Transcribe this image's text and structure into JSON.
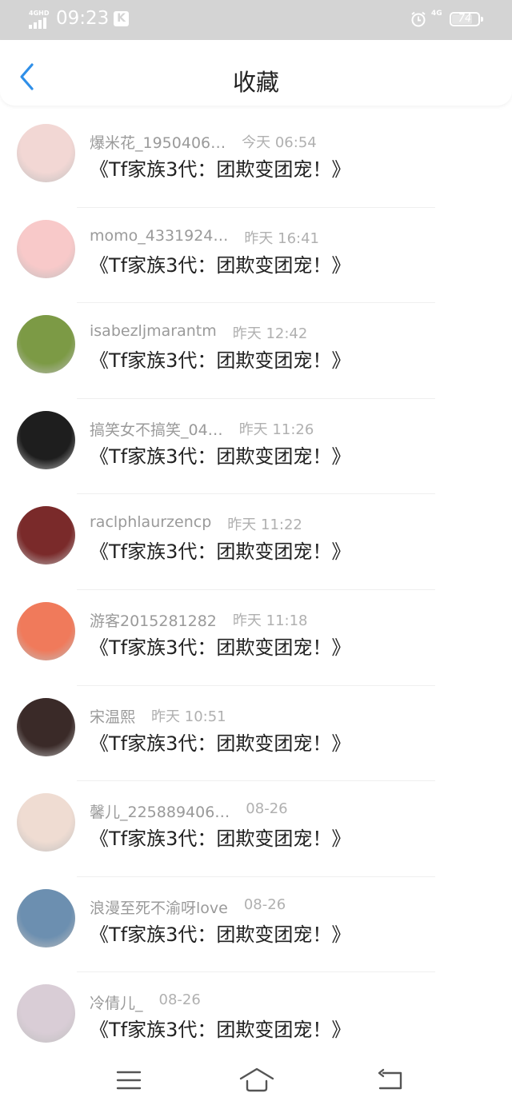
{
  "status_bar": {
    "network_label": "4GHD",
    "time": "09:23",
    "badge": "K",
    "network_right": "4G",
    "battery_percent": "74",
    "battery_level": 0.74,
    "icons": [
      "signal-icon",
      "k-app-icon",
      "alarm-icon",
      "battery-icon"
    ]
  },
  "header": {
    "back_icon": "chevron-left-icon",
    "title": "收藏",
    "accent_color": "#2f8fe8"
  },
  "list": {
    "items": [
      {
        "user": "爆米花_1950406…",
        "time": "今天 06:54",
        "title": "《Tf家族3代：团欺变团宠！》",
        "avatar_color": "#f2d7d4"
      },
      {
        "user": "momo_4331924…",
        "time": "昨天 16:41",
        "title": "《Tf家族3代：团欺变团宠！》",
        "avatar_color": "#f8c9c9"
      },
      {
        "user": "isabezljmarantm",
        "time": "昨天 12:42",
        "title": "《Tf家族3代：团欺变团宠！》",
        "avatar_color": "#7c9a45"
      },
      {
        "user": "搞笑女不搞笑_04…",
        "time": "昨天 11:26",
        "title": "《Tf家族3代：团欺变团宠！》",
        "avatar_color": "#1e1e1e"
      },
      {
        "user": "raclphlaurzencp",
        "time": "昨天 11:22",
        "title": "《Tf家族3代：团欺变团宠！》",
        "avatar_color": "#7a2a2a"
      },
      {
        "user": "游客2015281282",
        "time": "昨天 11:18",
        "title": "《Tf家族3代：团欺变团宠！》",
        "avatar_color": "#f07a5b"
      },
      {
        "user": "宋温熙",
        "time": "昨天 10:51",
        "title": "《Tf家族3代：团欺变团宠！》",
        "avatar_color": "#3a2a28"
      },
      {
        "user": "馨儿_225889406…",
        "time": "08-26",
        "title": "《Tf家族3代：团欺变团宠！》",
        "avatar_color": "#efdcd2"
      },
      {
        "user": "浪漫至死不渝呀love",
        "time": "08-26",
        "title": "《Tf家族3代：团欺变团宠！》",
        "avatar_color": "#6c8fb0"
      },
      {
        "user": "冷倩儿_",
        "time": "08-26",
        "title": "《Tf家族3代：团欺变团宠！》",
        "avatar_color": "#d9cdd6"
      }
    ]
  },
  "nav_bar": {
    "menu_icon": "menu-icon",
    "home_icon": "home-icon",
    "back_icon": "back-arrow-icon",
    "icon_color": "#555555"
  }
}
